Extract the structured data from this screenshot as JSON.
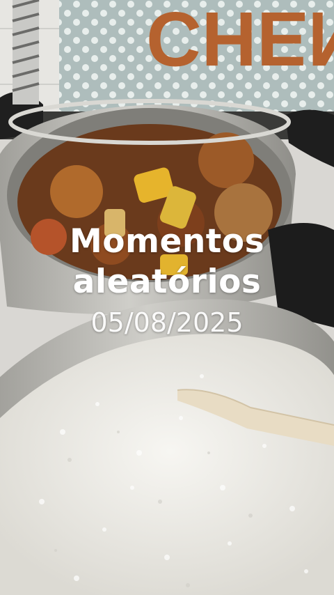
{
  "overlay": {
    "title_line1": "Momentos",
    "title_line2": "aleatórios",
    "date": "05/08/2025"
  },
  "wall_sign_text": "CHEN",
  "colors": {
    "overlay_text": "#ffffff",
    "wall_tile": "#b9c4c3",
    "pot_metal": "#b8b7b2",
    "rice": "#eeece6",
    "stew": "#8a4a22",
    "pepper": "#e2b32e"
  }
}
